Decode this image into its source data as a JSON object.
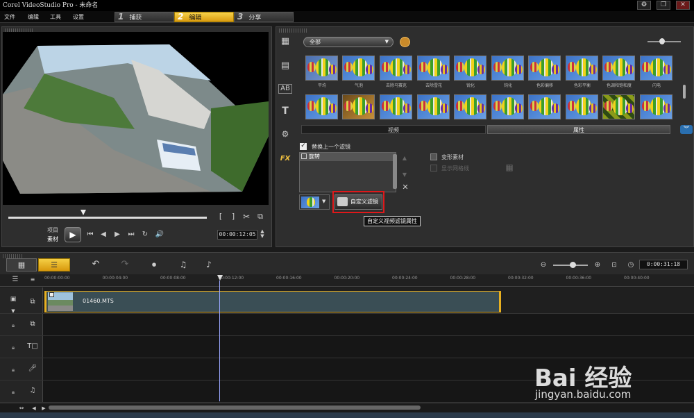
{
  "window": {
    "title": "Corel VideoStudio Pro - 未命名",
    "help": "❂",
    "restore": "❐",
    "close": "✕"
  },
  "menu": [
    "文件",
    "编辑",
    "工具",
    "设置"
  ],
  "steps": [
    {
      "num": "1",
      "label": "捕获"
    },
    {
      "num": "2",
      "label": "编辑"
    },
    {
      "num": "3",
      "label": "分享"
    }
  ],
  "player": {
    "project_label": "项目",
    "clip_label": "素材",
    "timecode": "00:00:12:05"
  },
  "library": {
    "category": "全部",
    "row1_labels": [
      "平均",
      "气泡",
      "去除马赛克",
      "去除雪花",
      "锐化",
      "钝化",
      "色彩偏移",
      "色彩平衡",
      "色调和饱和度",
      "闪电"
    ],
    "row2_labels": [
      "",
      "",
      "",
      "",
      "",
      "",
      "",
      "",
      "",
      ""
    ],
    "tab_video": "视频",
    "tab_attributes": "属性"
  },
  "attributes": {
    "replace_label": "替换上一个滤镜",
    "filter_item": "旋转",
    "deform_label": "变形素材",
    "grid_label": "显示网格线",
    "custom_filter_button": "自定义滤镜",
    "tooltip": "自定义视频滤镜属性"
  },
  "timeline": {
    "timecode": "0:00:31:18",
    "ticks": [
      "00:00:00:00",
      "00:00:04:00",
      "00:00:08:00",
      "00:00:12:00",
      "00:00:16:00",
      "00:00:20:00",
      "00:00:24:00",
      "00:00:28:00",
      "00:00:32:00",
      "00:00:36:00",
      "00:00:40:00"
    ],
    "clip_name": "01460.MTS"
  },
  "watermark": {
    "brand": "Bai 经验",
    "url": "jingyan.baidu.com"
  }
}
